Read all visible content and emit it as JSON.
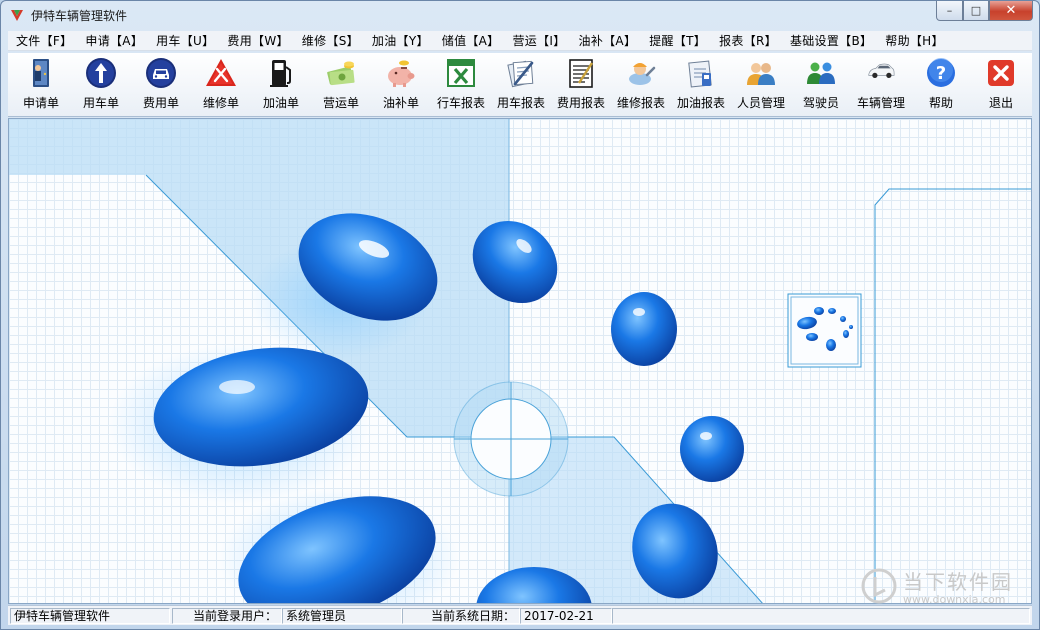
{
  "window": {
    "title": "伊特车辆管理软件",
    "controls": {
      "minimize": "–",
      "maximize": "□",
      "close": "✕"
    }
  },
  "menu": [
    "文件【F】",
    "申请【A】",
    "用车【U】",
    "费用【W】",
    "维修【S】",
    "加油【Y】",
    "储值【A】",
    "营运【I】",
    "油补【A】",
    "提醒【T】",
    "报表【R】",
    "基础设置【B】",
    "帮助【H】"
  ],
  "toolbar": [
    {
      "label": "申请单",
      "icon": "door-person-icon"
    },
    {
      "label": "用车单",
      "icon": "up-arrow-icon"
    },
    {
      "label": "费用单",
      "icon": "car-front-icon"
    },
    {
      "label": "维修单",
      "icon": "warning-tools-icon"
    },
    {
      "label": "加油单",
      "icon": "fuel-pump-icon"
    },
    {
      "label": "营运单",
      "icon": "money-icon"
    },
    {
      "label": "油补单",
      "icon": "piggy-bank-icon"
    },
    {
      "label": "行车报表",
      "icon": "excel-icon"
    },
    {
      "label": "用车报表",
      "icon": "documents-pen-icon"
    },
    {
      "label": "费用报表",
      "icon": "notepad-icon"
    },
    {
      "label": "维修报表",
      "icon": "repair-worker-icon"
    },
    {
      "label": "加油报表",
      "icon": "fuel-report-icon"
    },
    {
      "label": "人员管理",
      "icon": "people-icon"
    },
    {
      "label": "驾驶员",
      "icon": "driver-icon"
    },
    {
      "label": "车辆管理",
      "icon": "white-car-icon"
    },
    {
      "label": "帮助",
      "icon": "help-icon"
    },
    {
      "label": "退出",
      "icon": "exit-icon"
    }
  ],
  "status": {
    "app_name": "伊特车辆管理软件",
    "user_label": "当前登录用户：",
    "user_value": "系统管理员",
    "date_label": "当前系统日期：",
    "date_value": "2017-02-21"
  },
  "watermark": {
    "main": "当下软件园",
    "sub": "www.downxia.com"
  },
  "colors": {
    "accent_blue": "#1565d8",
    "close_red": "#c8412c",
    "exit_red": "#e03a2a"
  }
}
